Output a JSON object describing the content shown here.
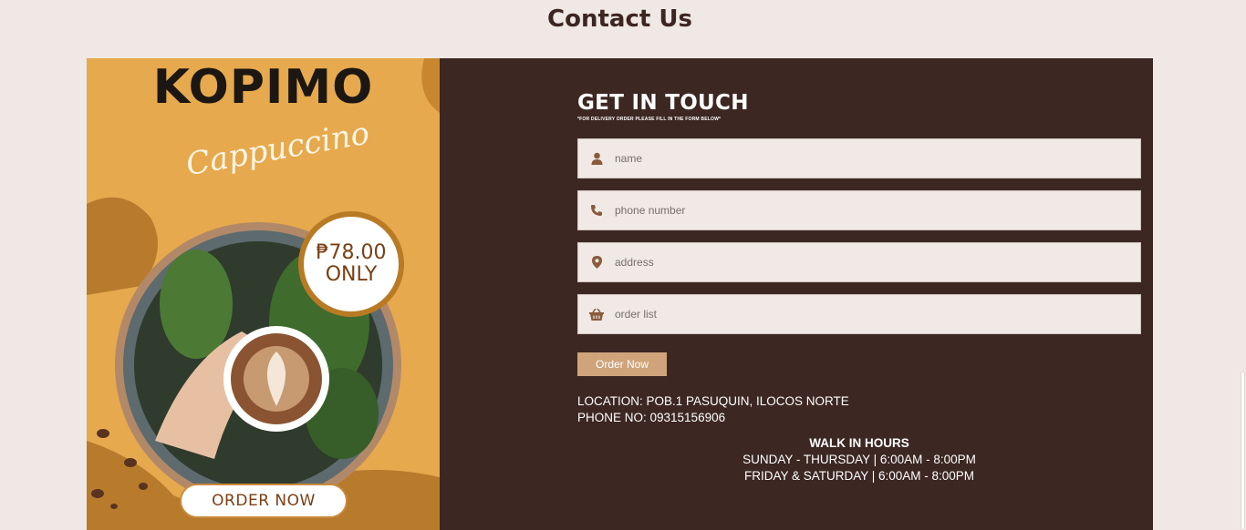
{
  "page": {
    "title": "Contact Us"
  },
  "promo": {
    "brand": "KOPIMO",
    "product": "Cappuccino",
    "price": "₱78.00",
    "price_note": "ONLY",
    "cta": "ORDER NOW"
  },
  "form": {
    "title": "GET IN TOUCH",
    "subtitle": "*FOR DELIVERY ORDER PLEASE FILL IN THE FORM BELOW*",
    "fields": [
      {
        "icon": "user-icon",
        "placeholder": "name"
      },
      {
        "icon": "phone-icon",
        "placeholder": "phone number"
      },
      {
        "icon": "map-pin-icon",
        "placeholder": "address"
      },
      {
        "icon": "basket-icon",
        "placeholder": "order list"
      }
    ],
    "submit_label": "Order Now"
  },
  "info": {
    "location": "LOCATION: POB.1 PASUQUIN, ILOCOS NORTE",
    "phone": "PHONE NO: 09315156906"
  },
  "hours": {
    "title": "WALK IN HOURS",
    "lines": [
      "SUNDAY - THURSDAY | 6:00AM - 8:00PM",
      "FRIDAY & SATURDAY | 6:00AM - 8:00PM"
    ]
  },
  "colors": {
    "background": "#efe8e4",
    "panel": "#3c2722",
    "promo": "#e6a94e",
    "button": "#cfa47a"
  }
}
